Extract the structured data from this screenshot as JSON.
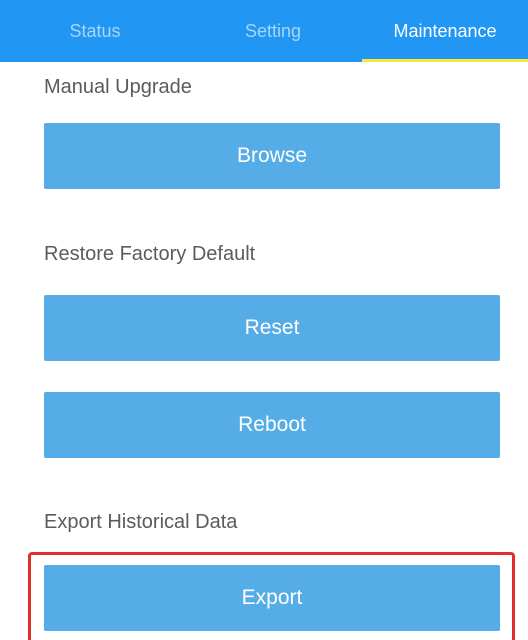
{
  "tabs": [
    {
      "label": "Status",
      "active": false
    },
    {
      "label": "Setting",
      "active": false
    },
    {
      "label": "Maintenance",
      "active": true
    }
  ],
  "sections": {
    "upgrade_label": "Manual Upgrade",
    "restore_label": "Restore Factory Default",
    "export_label": "Export Historical Data"
  },
  "buttons": {
    "browse": "Browse",
    "reset": "Reset",
    "reboot": "Reboot",
    "export": "Export"
  },
  "colors": {
    "tabbar_bg": "#2196F3",
    "tab_indicator": "#F5E642",
    "button_bg": "#55ACE6",
    "highlight_border": "#e0302a"
  }
}
